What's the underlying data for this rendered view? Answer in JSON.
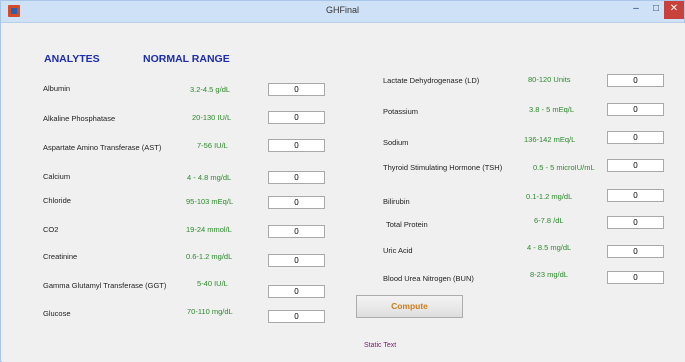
{
  "window": {
    "title": "GHFinal",
    "minimize": "–",
    "maximize": "□",
    "close": "✕"
  },
  "headers": {
    "analytes": "ANALYTES",
    "normal_range": "NORMAL RANGE"
  },
  "left_tests": [
    {
      "label": "Albumin",
      "range": "3.2-4.5 g/dL",
      "value": "0"
    },
    {
      "label": "Alkaline Phosphatase",
      "range": "20-130 IU/L",
      "value": "0"
    },
    {
      "label": "Aspartate Amino Transferase (AST)",
      "range": "7-56 IU/L",
      "value": "0"
    },
    {
      "label": "Calcium",
      "range": "4 - 4.8 mg/dL",
      "value": "0"
    },
    {
      "label": "Chloride",
      "range": "95-103 mEq/L",
      "value": "0"
    },
    {
      "label": "CO2",
      "range": "19-24 mmol/L",
      "value": "0"
    },
    {
      "label": "Creatinine",
      "range": "0.6-1.2 mg/dL",
      "value": "0"
    },
    {
      "label": "Gamma Glutamyl Transferase (GGT)",
      "range": "5-40 IU/L",
      "value": "0"
    },
    {
      "label": "Glucose",
      "range": "70-110 mg/dL",
      "value": "0"
    }
  ],
  "right_tests": [
    {
      "label": "Lactate Dehydrogenase (LD)",
      "range": "80-120 Units",
      "value": "0"
    },
    {
      "label": "Potassium",
      "range": "3.8 - 5 mEq/L",
      "value": "0"
    },
    {
      "label": "Sodium",
      "range": "136-142 mEq/L",
      "value": "0"
    },
    {
      "label": "Thyroid Stimulating Hormone (TSH)",
      "range": "0.5 - 5 microIU/mL",
      "value": "0"
    },
    {
      "label": "Bilirubin",
      "range": "0.1-1.2 mg/dL",
      "value": "0"
    },
    {
      "label": "Total Protein",
      "range": "6-7.8 /dL",
      "value": "0"
    },
    {
      "label": "Uric Acid",
      "range": "4 - 8.5 mg/dL",
      "value": "0"
    },
    {
      "label": "Blood Urea Nitrogen (BUN)",
      "range": "8-23 mg/dL",
      "value": "0"
    }
  ],
  "compute_label": "Compute",
  "static_text": "Static Text"
}
